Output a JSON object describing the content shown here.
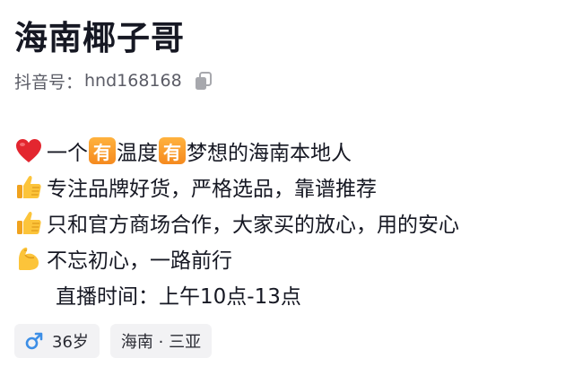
{
  "profile": {
    "name": "海南椰子哥",
    "id_label": "抖音号：",
    "id_value": "hnd168168"
  },
  "bio": {
    "line1_a": "一个",
    "badge": "有",
    "line1_b": "温度",
    "line1_c": "梦想的海南本地人",
    "line2": "专注品牌好货，严格选品，靠谱推荐",
    "line3": "只和官方商场合作，大家买的放心，用的安心",
    "line4": "不忘初心，一路前行",
    "line5": "直播时间：上午10点-13点"
  },
  "tags": {
    "age": "36岁",
    "location": "海南 · 三亚"
  },
  "icons": {
    "copy": "copy-icon",
    "heart": "red-heart-emoji",
    "thumbs_up": "thumbs-up-emoji",
    "flexed_biceps": "flexed-biceps-emoji",
    "male": "male-sign-icon"
  },
  "colors": {
    "text": "#161823",
    "secondary_text": "#5b5c66",
    "badge_orange": "#f58a1f",
    "male_blue": "#3c8ee6",
    "tag_bg": "#f2f2f4"
  }
}
